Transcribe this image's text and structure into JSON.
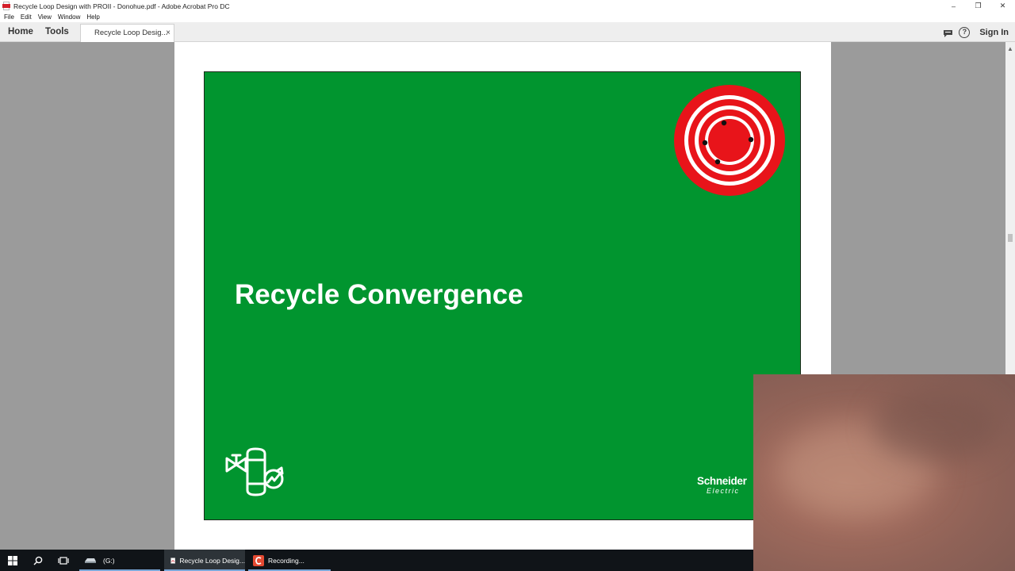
{
  "window": {
    "title": "Recycle Loop Design with PROII - Donohue.pdf - Adobe Acrobat Pro DC",
    "controls": {
      "minimize": "–",
      "restore": "❐",
      "close": "✕"
    }
  },
  "menu": {
    "items": [
      "File",
      "Edit",
      "View",
      "Window",
      "Help"
    ]
  },
  "toolbar": {
    "home_label": "Home",
    "tools_label": "Tools",
    "doc_tab_label": "Recycle Loop Desig...",
    "doc_tab_close": "×",
    "help_glyph": "?",
    "sign_in_label": "Sign In"
  },
  "slide": {
    "title": "Recycle Convergence",
    "brand_main": "Schneider",
    "brand_sub": "Electric",
    "background_color": "#01952f"
  },
  "scrollbar": {
    "up_arrow": "▲"
  },
  "taskbar": {
    "drive_label": "(G:)",
    "acrobat_label": "Recycle Loop Desig...",
    "recording_label": "Recording..."
  },
  "colors": {
    "slide_green": "#01952f",
    "target_red": "#e8141a",
    "acrobat_red": "#d4202b"
  }
}
